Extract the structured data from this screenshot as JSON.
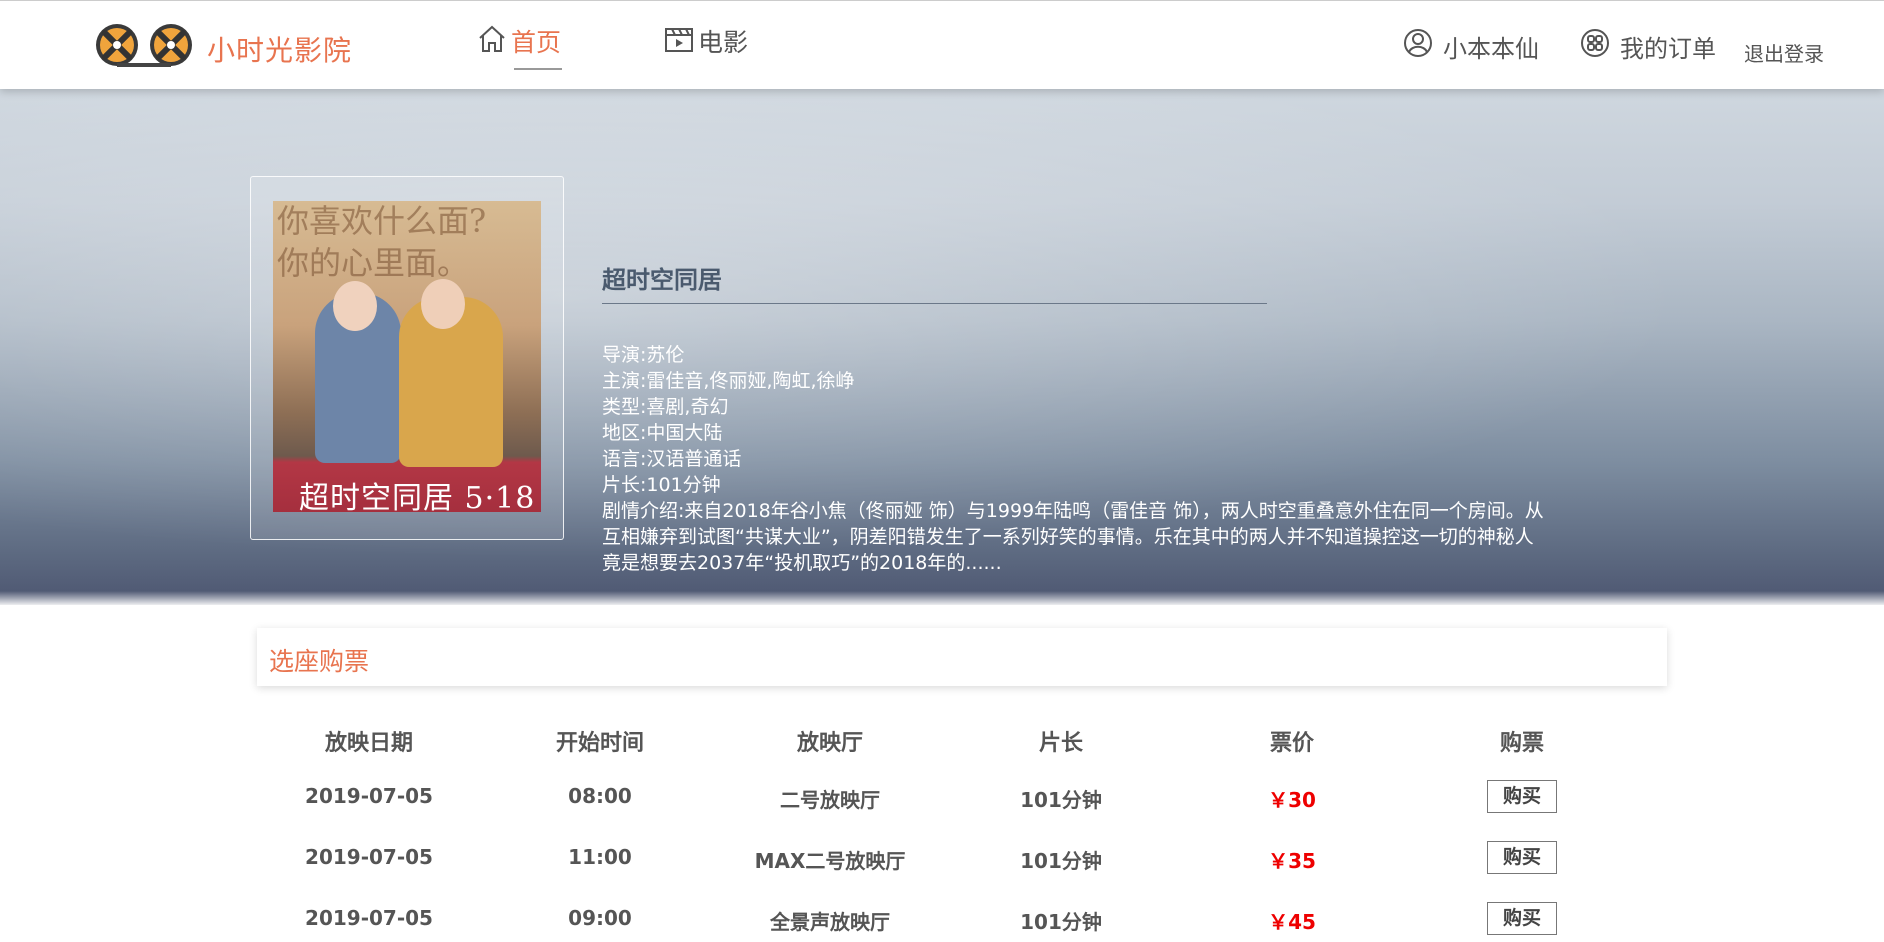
{
  "header": {
    "brand": "小时光影院",
    "nav": [
      {
        "label": "首页",
        "icon": "home-icon",
        "active": true
      },
      {
        "label": "电影",
        "icon": "film-icon",
        "active": false
      }
    ],
    "user_name": "小本本仙",
    "orders_label": "我的订单",
    "logout_label": "退出登录",
    "accent_color": "#e8744f"
  },
  "movie": {
    "title": "超时空同居",
    "director": "导演:苏伦",
    "cast": "主演:雷佳音,佟丽娅,陶虹,徐峥",
    "genre": "类型:喜剧,奇幻",
    "region": "地区:中国大陆",
    "language": "语言:汉语普通话",
    "duration": "片长:101分钟",
    "synopsis": "剧情介绍:来自2018年谷小焦（佟丽娅 饰）与1999年陆鸣（雷佳音 饰），两人时空重叠意外住在同一个房间。从互相嫌弃到试图“共谋大业”，阴差阳错发生了一系列好笑的事情。乐在其中的两人并不知道操控这一切的神秘人竟是想要去2037年“投机取巧”的2018年的......",
    "poster_text_line1": "你喜欢什么面?",
    "poster_text_line2": "你的心里面。",
    "poster_title": "超时空同居 5·18"
  },
  "tickets": {
    "section_title": "选座购票",
    "columns": [
      "放映日期",
      "开始时间",
      "放映厅",
      "片长",
      "票价",
      "购票"
    ],
    "rows": [
      {
        "date": "2019-07-05",
        "time": "08:00",
        "hall": "二号放映厅",
        "length": "101分钟",
        "price": "￥30",
        "action": "购买"
      },
      {
        "date": "2019-07-05",
        "time": "11:00",
        "hall": "MAX二号放映厅",
        "length": "101分钟",
        "price": "￥35",
        "action": "购买"
      },
      {
        "date": "2019-07-05",
        "time": "09:00",
        "hall": "全景声放映厅",
        "length": "101分钟",
        "price": "￥45",
        "action": "购买"
      }
    ],
    "price_color": "#e00000"
  }
}
